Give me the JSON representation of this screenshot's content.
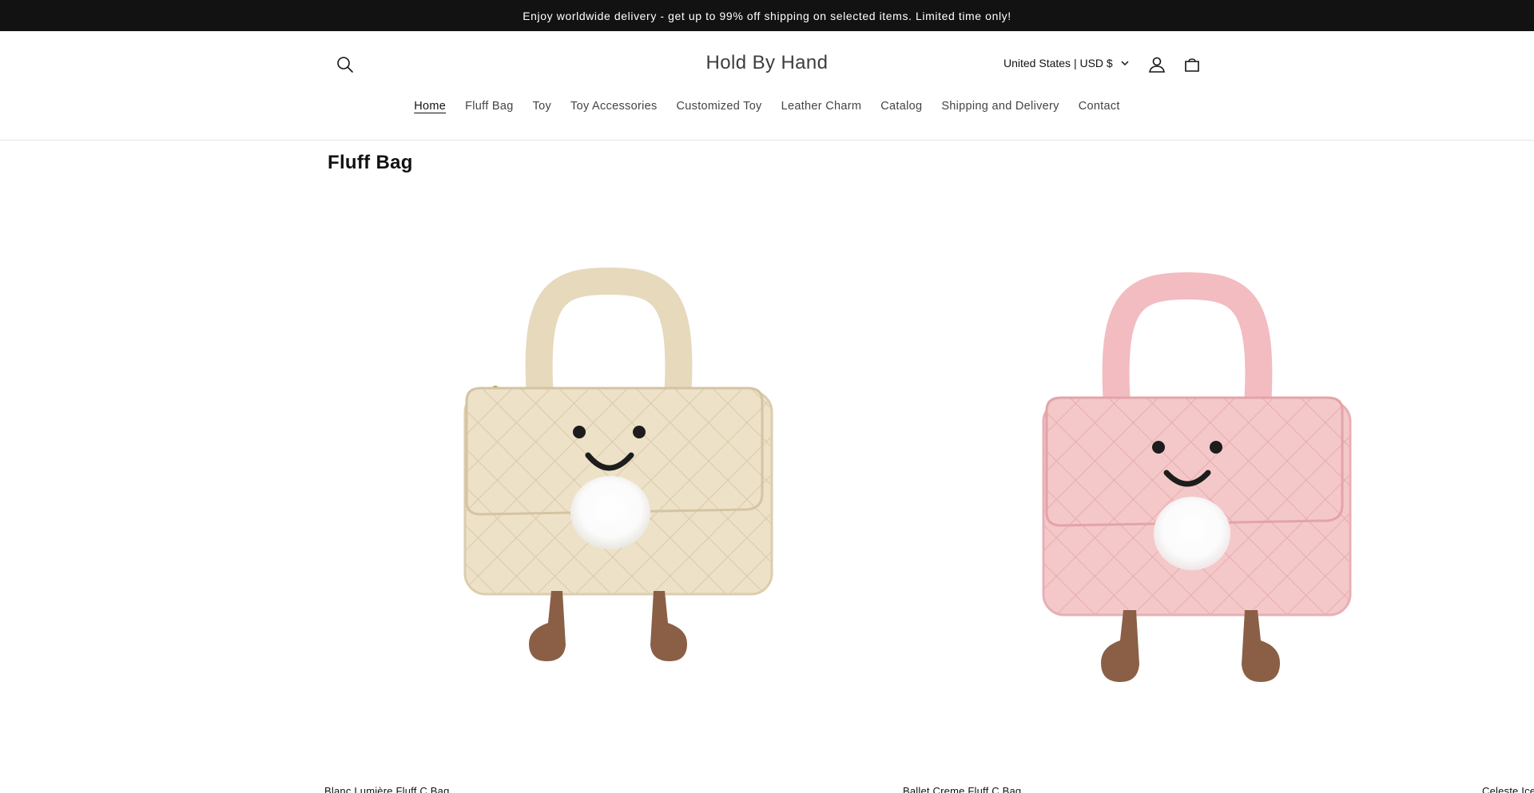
{
  "announcement": {
    "text": "Enjoy worldwide delivery - get up to 99% off shipping on selected items. Limited time only!"
  },
  "header": {
    "logo": "Hold By Hand",
    "locale": "United States | USD $",
    "icons": {
      "search": "search-icon",
      "account": "account-icon",
      "cart": "cart-icon",
      "locale_caret": "chevron-down-icon"
    }
  },
  "nav": {
    "items": [
      {
        "label": "Home",
        "active": true
      },
      {
        "label": "Fluff Bag"
      },
      {
        "label": "Toy"
      },
      {
        "label": "Toy Accessories"
      },
      {
        "label": "Customized Toy"
      },
      {
        "label": "Leather Charm"
      },
      {
        "label": "Catalog"
      },
      {
        "label": "Shipping and Delivery"
      },
      {
        "label": "Contact"
      }
    ]
  },
  "collection": {
    "title": "Fluff Bag",
    "products": [
      {
        "title": "Blanc Lumière Fluff C Bag",
        "color": "#ede1c8"
      },
      {
        "title": "Ballet Creme Fluff C Bag",
        "color": "#f4c8c9"
      },
      {
        "title": "Celeste Ice"
      }
    ]
  },
  "colors": {
    "announcement_bg": "#121212",
    "text": "#121212",
    "bag_cream": "#ede1c8",
    "bag_pink": "#f4c8c9",
    "legs": "#8a5f46"
  }
}
